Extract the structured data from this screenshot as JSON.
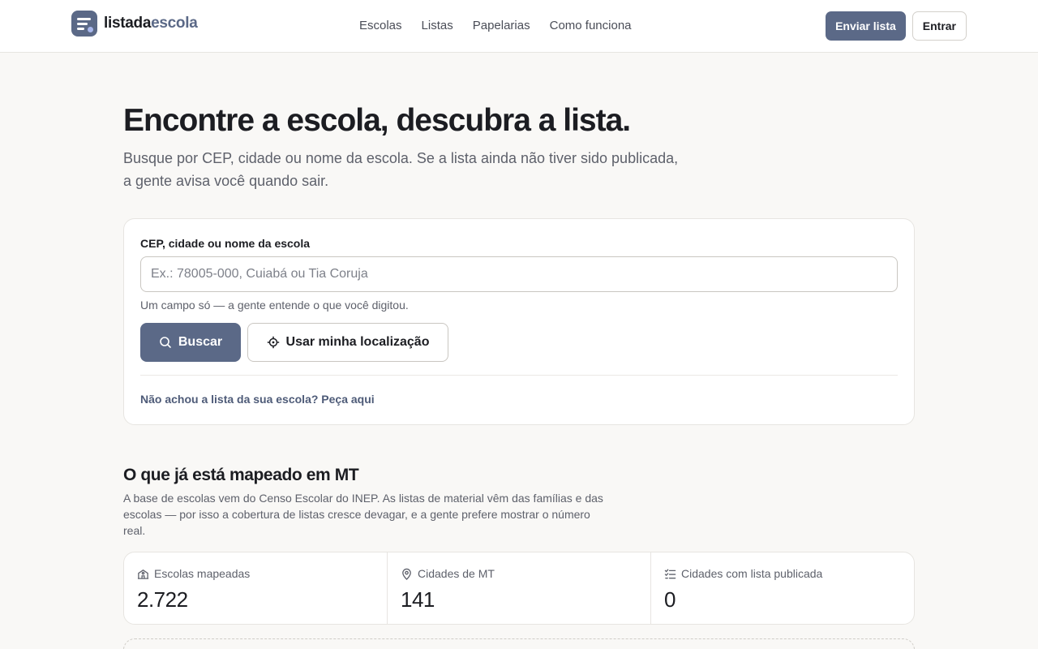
{
  "header": {
    "brand": {
      "part1": "lista",
      "part2": "da",
      "part3": "escola"
    },
    "nav": [
      "Escolas",
      "Listas",
      "Papelarias",
      "Como funciona"
    ],
    "send_list_label": "Enviar lista",
    "login_label": "Entrar"
  },
  "hero": {
    "title": "Encontre a escola, descubra a lista.",
    "subtitle_line1": "Busque por CEP, cidade ou nome da escola. Se a lista ainda não tiver sido publicada,",
    "subtitle_line2": "a gente avisa você quando sair."
  },
  "search": {
    "label": "CEP, cidade ou nome da escola",
    "placeholder": "Ex.: 78005-000, Cuiabá ou Tia Coruja",
    "value": "",
    "helper": "Um campo só — a gente entende o que você digitou.",
    "search_button": "Buscar",
    "location_button": "Usar minha localização",
    "request_link": "Não achou a lista da sua escola? Peça aqui"
  },
  "coverage": {
    "title": "O que já está mapeado em MT",
    "description": "A base de escolas vem do Censo Escolar do INEP. As listas de material vêm das famílias e das escolas — por isso a cobertura de listas cresce devagar, e a gente prefere mostrar o número real.",
    "stats": [
      {
        "icon": "school-icon",
        "label": "Escolas mapeadas",
        "value": "2.722"
      },
      {
        "icon": "map-pin-icon",
        "label": "Cidades de MT",
        "value": "141"
      },
      {
        "icon": "checklist-icon",
        "label": "Cidades com lista publicada",
        "value": "0"
      }
    ]
  },
  "colors": {
    "accent": "#5b6987",
    "background": "#f9f8f6",
    "surface": "#ffffff",
    "text": "#1c1d22",
    "muted_text": "#5e616b",
    "border": "#e7e5e1"
  }
}
